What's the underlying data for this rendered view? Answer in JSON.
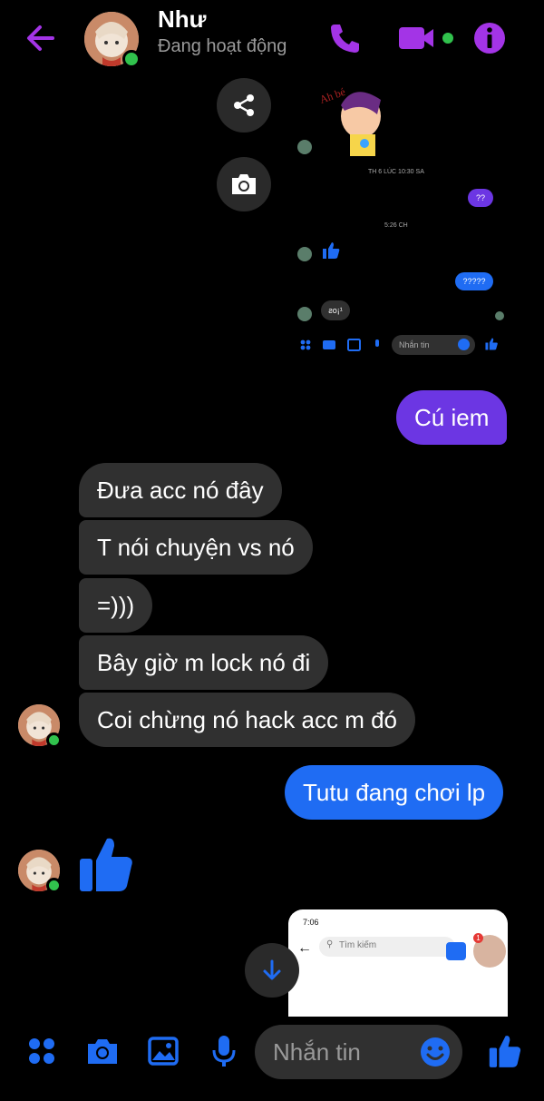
{
  "header": {
    "contact_name": "Như",
    "status": "Đang hoạt động"
  },
  "shot": {
    "timestamp1": "TH 6 LÚC 10:30 SA",
    "msg1": "??",
    "timestamp2": "5:26 CH",
    "msg2": "?????",
    "msg3": "ƨo¡¹",
    "input_placeholder": "Nhắn tin"
  },
  "messages": {
    "out1": "Cú iem",
    "in1": "Đưa acc nó đây",
    "in2": "T nói chuyện vs nó",
    "in3": "=)))",
    "in4": "Bây giờ m lock nó đi",
    "in5": "Coi chừng nó hack acc m đó",
    "out2": "Tutu đang chơi lp"
  },
  "preview": {
    "time": "7:06",
    "search_placeholder": "Tìm kiếm",
    "badge": "1"
  },
  "composer": {
    "placeholder": "Nhắn tin"
  },
  "colors": {
    "accent_purple": "#a334e6",
    "bubble_purple": "#6c36e3",
    "bubble_blue": "#1f6cf3",
    "incoming_bg": "#303030",
    "online_green": "#31c24d",
    "icon_blue": "#1f6cf3"
  }
}
